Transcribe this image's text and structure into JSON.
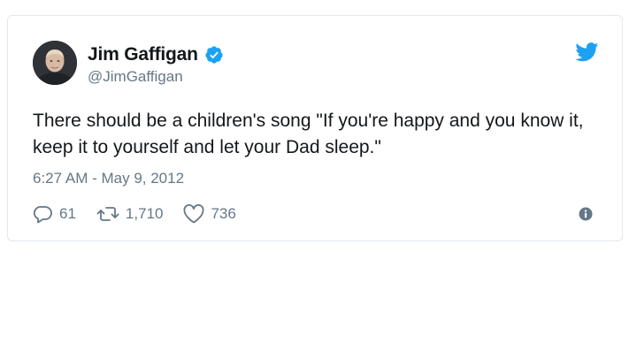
{
  "tweet": {
    "author": {
      "name": "Jim Gaffigan",
      "handle": "@JimGaffigan",
      "verified": true
    },
    "text": "There should be a children's song \"If you're happy and you know it, keep it to yourself and let your Dad sleep.\"",
    "timestamp": "6:27 AM - May 9, 2012",
    "stats": {
      "replies": "61",
      "retweets": "1,710",
      "likes": "736"
    },
    "icons": {
      "brand": "twitter-bird-icon",
      "verified": "verified-badge-icon",
      "reply": "reply-icon",
      "retweet": "retweet-icon",
      "like": "heart-icon",
      "info": "info-icon"
    }
  },
  "colors": {
    "brand_blue": "#1da1f2",
    "text_primary": "#14171a",
    "text_secondary": "#657786",
    "border": "#e1e8ed"
  }
}
